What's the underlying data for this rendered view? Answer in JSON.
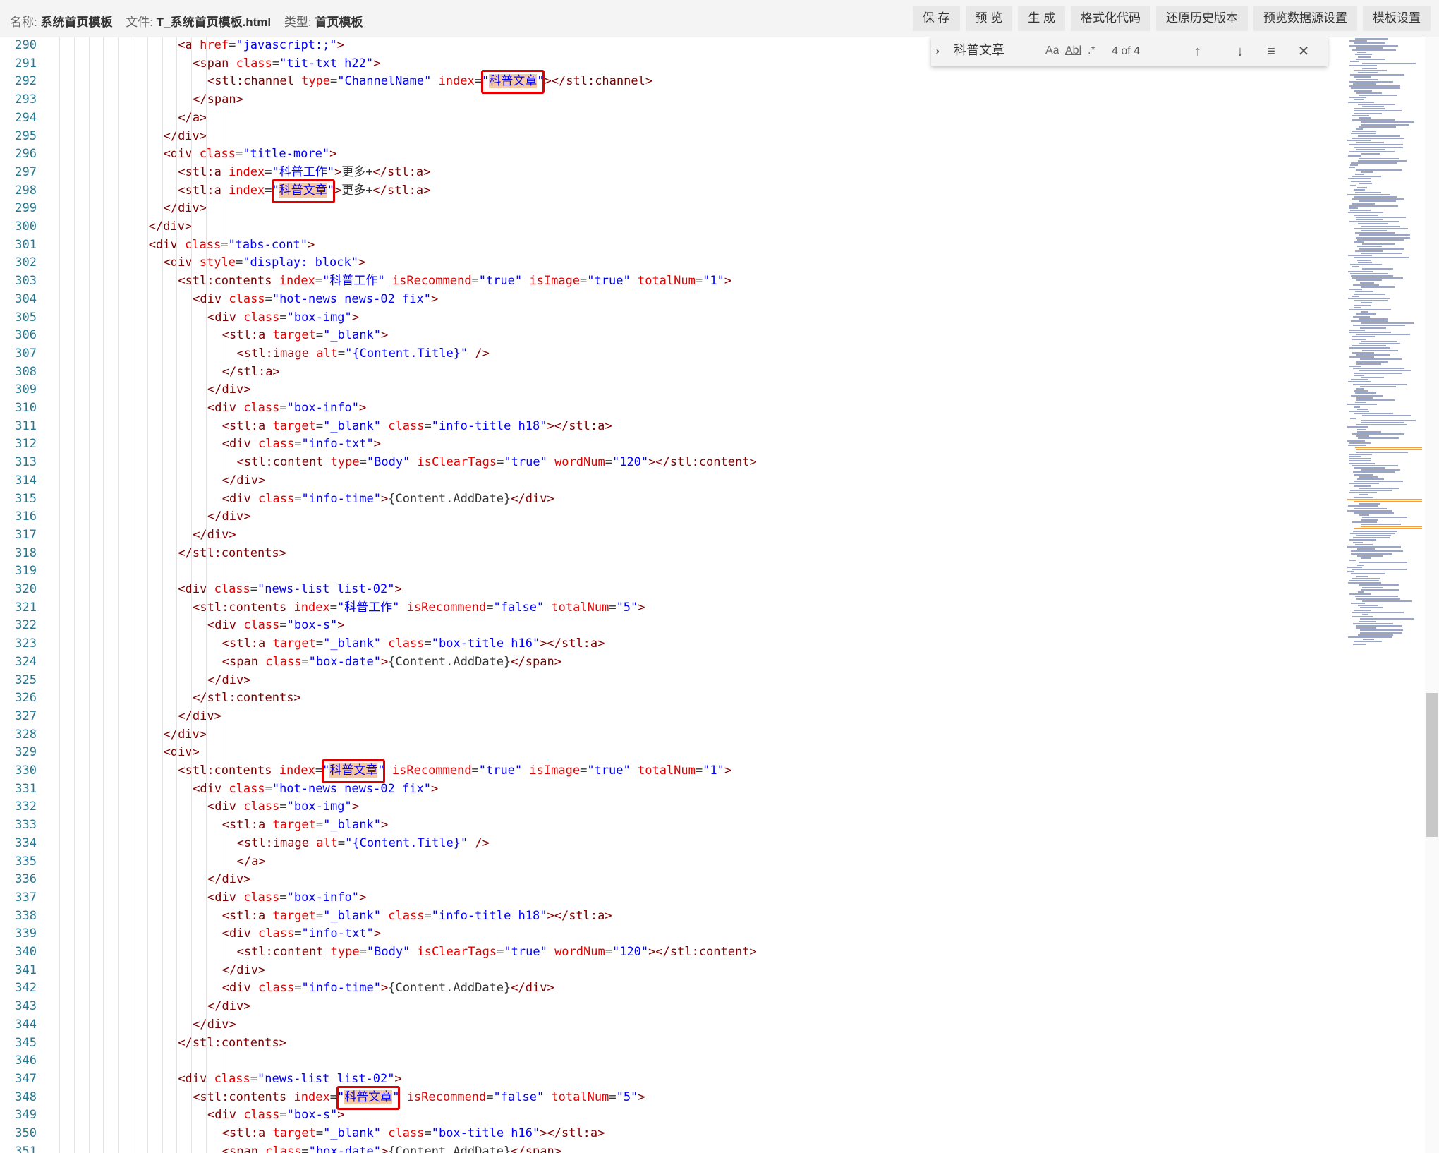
{
  "topbar": {
    "name_label": "名称:",
    "name_value": "系统首页模板",
    "file_label": "文件:",
    "file_value": "T_系统首页模板.html",
    "type_label": "类型:",
    "type_value": "首页模板",
    "buttons": [
      "保 存",
      "预 览",
      "生 成",
      "格式化代码",
      "还原历史版本",
      "预览数据源设置",
      "模板设置"
    ]
  },
  "find": {
    "query": "科普文章",
    "match_case": "Aa",
    "whole_word": "Abl",
    "regex": ".*",
    "count": "4 of 4"
  },
  "editor": {
    "first_line": 290,
    "lines": [
      "<a href=\"javascript:;\">",
      "<span class=\"tit-txt h22\">",
      "<stl:channel type=\"ChannelName\" index=\"科普文章\"></stl:channel>",
      "</span>",
      "</a>",
      "</div>",
      "<div class=\"title-more\">",
      "<stl:a index=\"科普工作\">更多+</stl:a>",
      "<stl:a index=\"科普文章\">更多+</stl:a>",
      "</div>",
      "</div>",
      "<div class=\"tabs-cont\">",
      "<div style=\"display: block\">",
      "<stl:contents index=\"科普工作\" isRecommend=\"true\" isImage=\"true\" totalNum=\"1\">",
      "<div class=\"hot-news news-02 fix\">",
      "<div class=\"box-img\">",
      "<stl:a target=\"_blank\">",
      "<stl:image alt=\"{Content.Title}\" />",
      "</stl:a>",
      "</div>",
      "<div class=\"box-info\">",
      "<stl:a target=\"_blank\" class=\"info-title h18\"></stl:a>",
      "<div class=\"info-txt\">",
      "<stl:content type=\"Body\" isClearTags=\"true\" wordNum=\"120\"></stl:content>",
      "</div>",
      "<div class=\"info-time\">{Content.AddDate}</div>",
      "</div>",
      "</div>",
      "</stl:contents>",
      "",
      "<div class=\"news-list list-02\">",
      "<stl:contents index=\"科普工作\" isRecommend=\"false\" totalNum=\"5\">",
      "<div class=\"box-s\">",
      "<stl:a target=\"_blank\" class=\"box-title h16\"></stl:a>",
      "<span class=\"box-date\">{Content.AddDate}</span>",
      "</div>",
      "</stl:contents>",
      "</div>",
      "</div>",
      "<div>",
      "<stl:contents index=\"科普文章\" isRecommend=\"true\" isImage=\"true\" totalNum=\"1\">",
      "<div class=\"hot-news news-02 fix\">",
      "<div class=\"box-img\">",
      "<stl:a target=\"_blank\">",
      "<stl:image alt=\"{Content.Title}\" />",
      "</a>",
      "</div>",
      "<div class=\"box-info\">",
      "<stl:a target=\"_blank\" class=\"info-title h18\"></stl:a>",
      "<div class=\"info-txt\">",
      "<stl:content type=\"Body\" isClearTags=\"true\" wordNum=\"120\"></stl:content>",
      "</div>",
      "<div class=\"info-time\">{Content.AddDate}</div>",
      "</div>",
      "</div>",
      "</stl:contents>",
      "",
      "<div class=\"news-list list-02\">",
      "<stl:contents index=\"科普文章\" isRecommend=\"false\" totalNum=\"5\">",
      "<div class=\"box-s\">",
      "<stl:a target=\"_blank\" class=\"box-title h16\"></stl:a>",
      "<span class=\"box-date\">{Content.AddDate}</span>"
    ]
  },
  "colors": {
    "tag": "#800000",
    "attr": "#e50000",
    "value": "#0000ff",
    "find_highlight": "#f7c9a3",
    "annotation_box": "#e00000",
    "line_number": "#237893"
  }
}
